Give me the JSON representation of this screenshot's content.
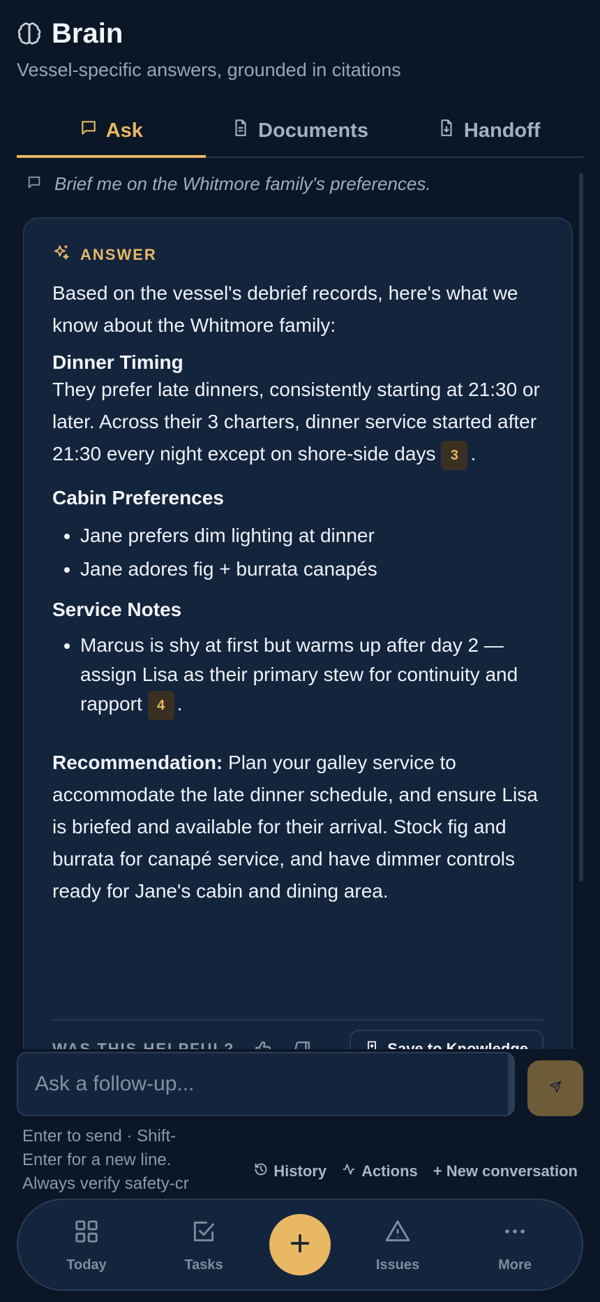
{
  "header": {
    "title": "Brain",
    "subtitle": "Vessel-specific answers, grounded in citations"
  },
  "tabs": [
    {
      "label": "Ask",
      "icon": "chat-bubble-icon",
      "active": true
    },
    {
      "label": "Documents",
      "icon": "document-icon",
      "active": false
    },
    {
      "label": "Handoff",
      "icon": "handoff-document-icon",
      "active": false
    }
  ],
  "question": "Brief me on the Whitmore family's preferences.",
  "answer": {
    "label": "ANSWER",
    "intro": "Based on the vessel's debrief records, here's what we know about the Whitmore family:",
    "dinner_heading": "Dinner Timing",
    "dinner_text": "They prefer late dinners, consistently starting at 21:30 or later. Across their 3 charters, dinner service started after 21:30 every night except on shore-side days",
    "dinner_cite": "3",
    "cabin_heading": "Cabin Preferences",
    "cabin_items": [
      "Jane prefers dim lighting at dinner",
      "Jane adores fig + burrata canapés"
    ],
    "service_heading": "Service Notes",
    "service_text": "Marcus is shy at first but warms up after day 2 — assign Lisa as their primary stew for continuity and rapport",
    "service_cite": "4",
    "reco_label": "Recommendation:",
    "reco_text": "Plan your galley service to accommodate the late dinner schedule, and ensure Lisa is briefed and available for their arrival. Stock fig and burrata for canapé service, and have dimmer controls ready for Jane's cabin and dining area."
  },
  "feedback": {
    "label": "WAS THIS HELPFUL?",
    "save_label": "Save to Knowledge"
  },
  "composer": {
    "placeholder": "Ask a follow-up...",
    "hint": "Enter to send · Shift-Enter for a new line. Always verify safety-cr"
  },
  "actions": {
    "history": "History",
    "actions": "Actions",
    "new_conversation": "+ New conversation"
  },
  "nav": {
    "today": "Today",
    "tasks": "Tasks",
    "issues": "Issues",
    "more": "More"
  },
  "colors": {
    "background": "#0b1626",
    "card": "#13243d",
    "accent": "#e8b863",
    "muted": "#97a6b8"
  }
}
